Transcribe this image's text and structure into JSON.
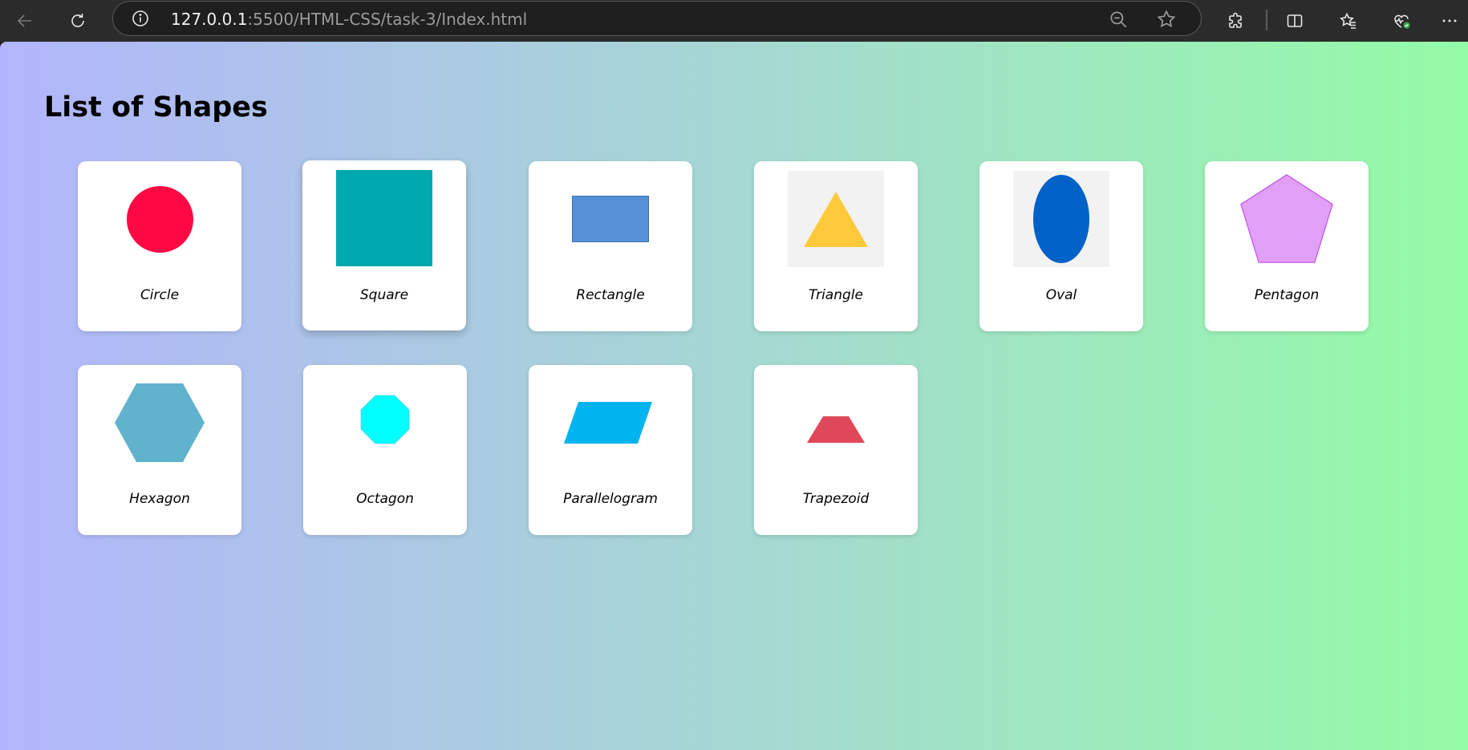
{
  "browser": {
    "url_host": "127.0.0.1",
    "url_path": ":5500/HTML-CSS/task-3/Index.html",
    "icons": [
      "back-icon",
      "refresh-icon",
      "info-icon",
      "zoom-out-icon",
      "favorite-star-icon",
      "extensions-icon",
      "split-screen-icon",
      "favorites-icon",
      "browser-essentials-icon",
      "more-icon"
    ]
  },
  "page": {
    "title": "List of Shapes",
    "background_gradient": [
      "#b2b5fb",
      "#a6d6d4",
      "#94fba6"
    ]
  },
  "shapes": [
    {
      "label": "Circle",
      "color": "#ff0844"
    },
    {
      "label": "Square",
      "color": "#00a8b0"
    },
    {
      "label": "Rectangle",
      "color": "#5690d6"
    },
    {
      "label": "Triangle",
      "color": "#ffc93c"
    },
    {
      "label": "Oval",
      "color": "#0061c7"
    },
    {
      "label": "Pentagon",
      "color": "#e1a0f7"
    },
    {
      "label": "Hexagon",
      "color": "#61b2cd"
    },
    {
      "label": "Octagon",
      "color": "#00ffff"
    },
    {
      "label": "Parallelogram",
      "color": "#00b4f0"
    },
    {
      "label": "Trapezoid",
      "color": "#e0485a"
    }
  ]
}
